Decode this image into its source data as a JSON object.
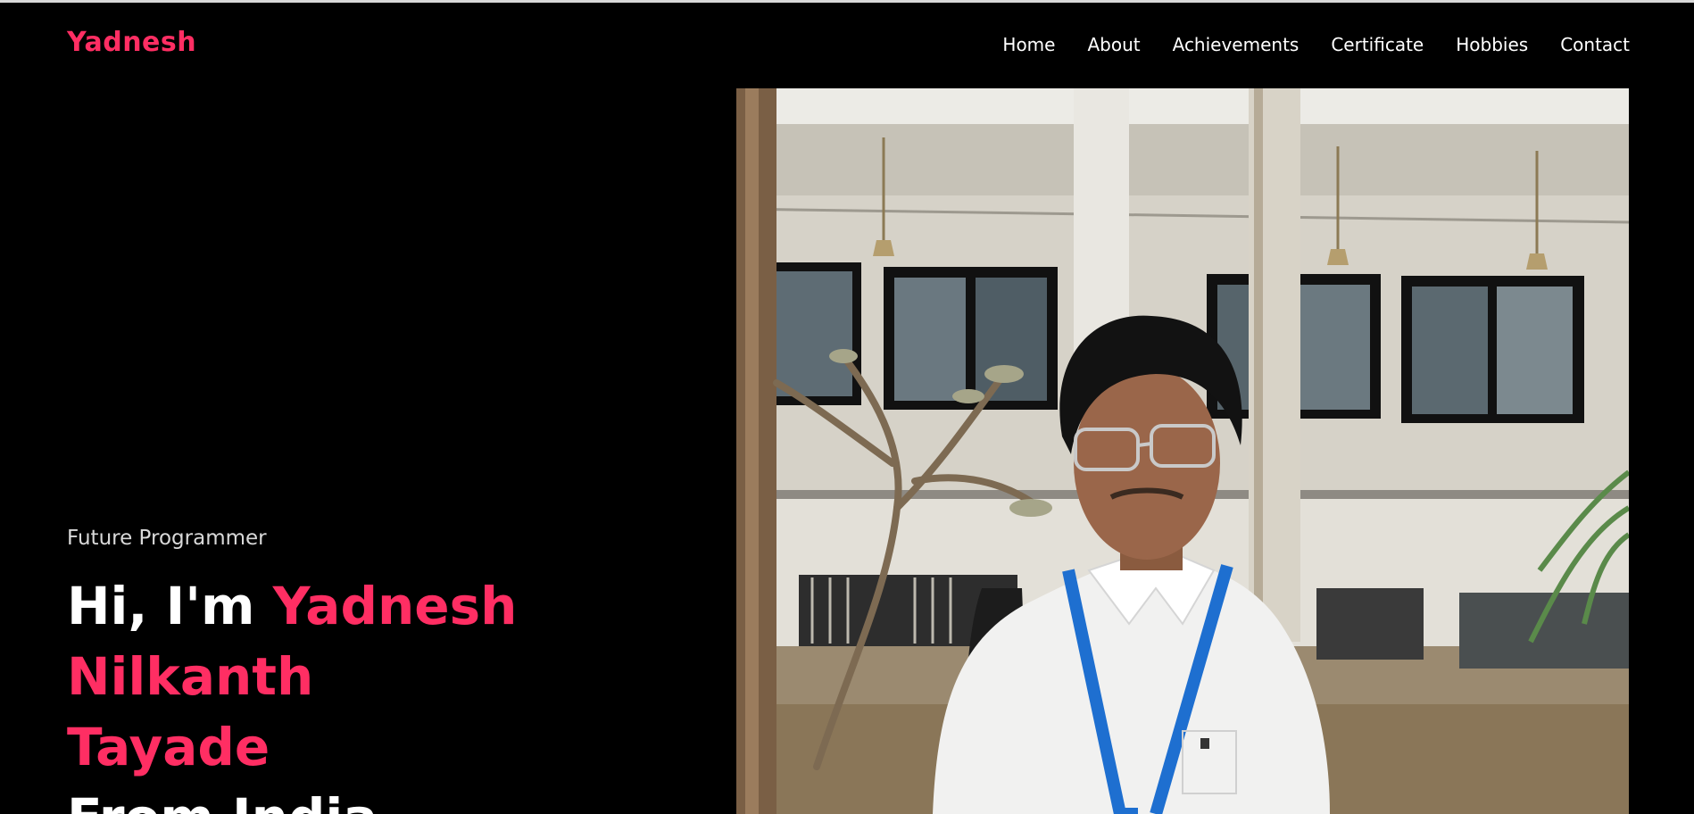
{
  "brand": "Yadnesh",
  "nav": {
    "items": [
      "Home",
      "About",
      "Achievements",
      "Certificate",
      "Hobbies",
      "Contact"
    ]
  },
  "hero": {
    "tagline": "Future Programmer",
    "greeting": "Hi, I'm",
    "name_line1": "Yadnesh Nilkanth",
    "name_line2": "Tayade",
    "origin": "From India"
  },
  "colors": {
    "accent": "#ff2e63",
    "background": "#000000",
    "text": "#ffffff"
  },
  "photo": {
    "subject": "profile-photo"
  }
}
